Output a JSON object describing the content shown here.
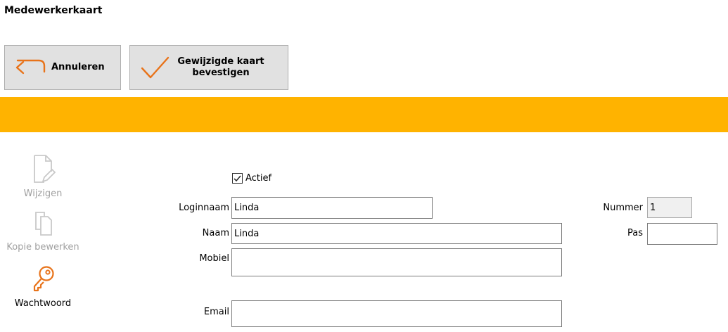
{
  "window": {
    "title": "Medewerkerkaart"
  },
  "toolbar": {
    "cancel_label": "Annuleren",
    "confirm_label_line1": "Gewijzigde kaart",
    "confirm_label_line2": "bevestigen"
  },
  "sidebar": {
    "items": [
      {
        "label": "Wijzigen",
        "icon": "edit-document-icon",
        "enabled": false
      },
      {
        "label": "Kopie bewerken",
        "icon": "copy-icon",
        "enabled": false
      },
      {
        "label": "Wachtwoord",
        "icon": "key-icon",
        "enabled": true
      }
    ]
  },
  "form": {
    "actief": {
      "label": "Actief",
      "checked": true
    },
    "loginnaam": {
      "label": "Loginnaam",
      "value": "Linda"
    },
    "naam": {
      "label": "Naam",
      "value": "Linda"
    },
    "mobiel": {
      "label": "Mobiel",
      "value": ""
    },
    "email": {
      "label": "Email",
      "value": ""
    },
    "nummer": {
      "label": "Nummer",
      "value": "1"
    },
    "pas": {
      "label": "Pas",
      "value": ""
    }
  },
  "colors": {
    "accent": "#e8731a",
    "banner": "#ffb300",
    "button_bg": "#e1e1e1",
    "disabled": "#a0a0a0"
  }
}
